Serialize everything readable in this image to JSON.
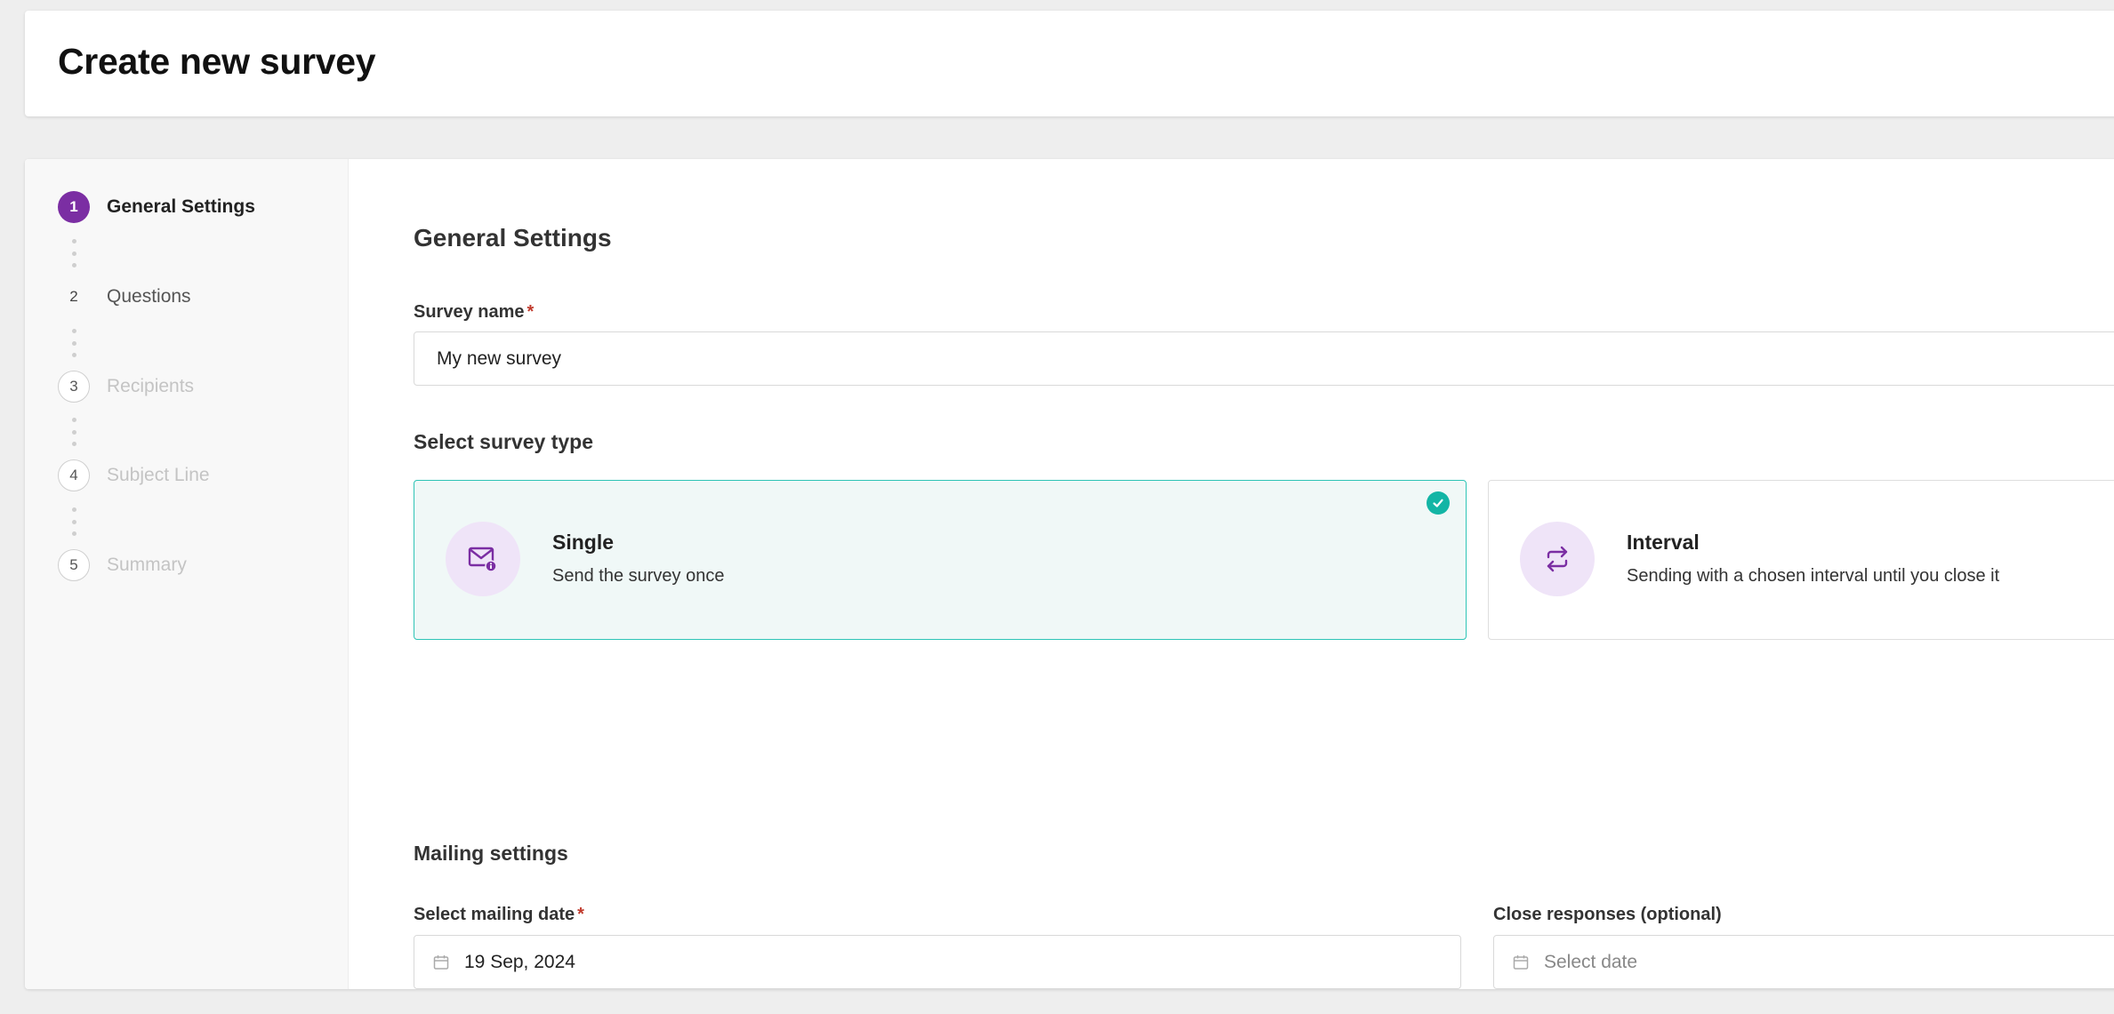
{
  "header": {
    "title": "Create new survey"
  },
  "stepper": {
    "steps": [
      {
        "number": "1",
        "label": "General Settings",
        "state": "active"
      },
      {
        "number": "2",
        "label": "Questions",
        "state": "normal"
      },
      {
        "number": "3",
        "label": "Recipients",
        "state": "disabled"
      },
      {
        "number": "4",
        "label": "Subject Line",
        "state": "disabled"
      },
      {
        "number": "5",
        "label": "Summary",
        "state": "disabled"
      }
    ]
  },
  "form": {
    "section_title": "General Settings",
    "survey_name": {
      "label": "Survey name",
      "required_mark": "*",
      "value": "My new survey"
    },
    "survey_type": {
      "title": "Select survey type",
      "options": [
        {
          "title": "Single",
          "description": "Send the survey once",
          "icon": "mail-info-icon",
          "selected": true
        },
        {
          "title": "Interval",
          "description": "Sending with a chosen interval until you close it",
          "icon": "repeat-icon",
          "selected": false
        }
      ]
    },
    "mailing": {
      "title": "Mailing settings",
      "mailing_date": {
        "label": "Select mailing date",
        "required_mark": "*",
        "value": "19 Sep, 2024"
      },
      "close_responses": {
        "label": "Close responses (optional)",
        "placeholder": "Select date"
      }
    }
  },
  "colors": {
    "accent_purple": "#7b2ea3",
    "selected_teal": "#2ec4b6",
    "selected_bg": "#f0f8f7",
    "icon_bg": "#efe4f8",
    "required_red": "#c0392b"
  }
}
